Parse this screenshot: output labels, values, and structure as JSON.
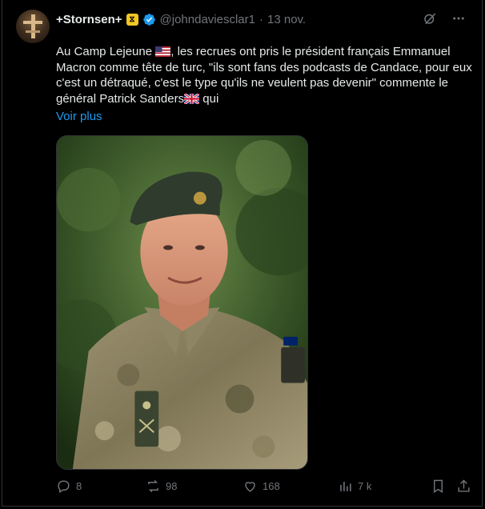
{
  "tweet": {
    "display_name": "+Stornsen+",
    "handle": "@johndaviesclar1",
    "separator": "·",
    "date": "13 nov.",
    "text_parts": {
      "p1": "Au Camp Lejeune ",
      "p2": ", les recrues ont pris le président français Emmanuel Macron comme tête de turc, \"ils sont fans des podcasts de Candace, pour eux c'est un détraqué, c'est le type qu'ils ne veulent pas devenir\" commente le général Patrick Sanders",
      "p3": " qui"
    },
    "show_more": "Voir plus"
  },
  "actions": {
    "replies": "8",
    "reposts": "98",
    "likes": "168",
    "views": "7 k"
  },
  "icons": {
    "verified": "verified-badge-icon",
    "grok": "grok-icon",
    "more": "more-icon",
    "reply": "reply-icon",
    "repost": "repost-icon",
    "like": "heart-icon",
    "views": "views-icon",
    "bookmark": "bookmark-icon",
    "share": "share-icon"
  },
  "colors": {
    "background": "#000000",
    "text": "#e7e9ea",
    "muted": "#71767b",
    "link": "#1d9bf0",
    "verified": "#1d9bf0"
  }
}
